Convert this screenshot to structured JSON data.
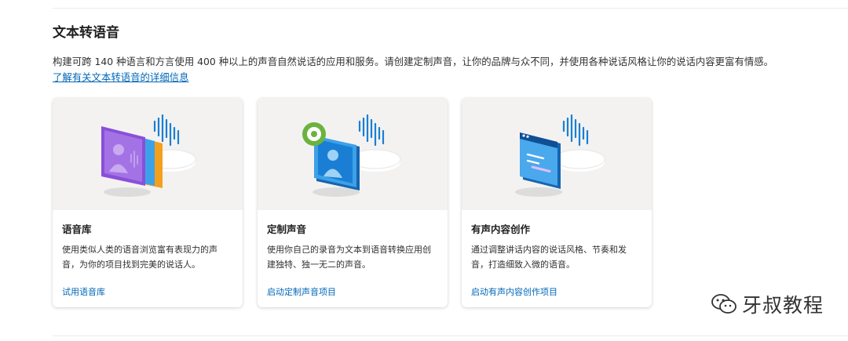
{
  "section": {
    "title": "文本转语音",
    "description": "构建可跨 140 种语言和方言使用 400 种以上的声音自然说话的应用和服务。请创建定制声音，让你的品牌与众不同，并使用各种说话风格让你的说话内容更富有情感。",
    "learn_more": "了解有关文本转语音的详细信息"
  },
  "cards": [
    {
      "title": "语音库",
      "text": "使用类似人类的语音浏览富有表现力的声音，为你的项目找到完美的说话人。",
      "link": "试用语音库",
      "icon": "voice-gallery-illustration"
    },
    {
      "title": "定制声音",
      "text": "使用你自己的录音为文本到语音转换应用创建独特、独一无二的声音。",
      "link": "启动定制声音项目",
      "icon": "custom-voice-illustration"
    },
    {
      "title": "有声内容创作",
      "text": "通过调整讲话内容的说话风格、节奏和发音，打造细致入微的语音。",
      "link": "启动有声内容创作项目",
      "icon": "audio-content-illustration"
    }
  ],
  "watermark": {
    "text": "牙叔教程",
    "icon": "wechat-icon"
  },
  "colors": {
    "link": "#0067b8",
    "media_bg": "#f3f2f1",
    "accent_blue": "#1a7fd4",
    "accent_purple": "#8a4fd8",
    "accent_green": "#6bb33e"
  }
}
